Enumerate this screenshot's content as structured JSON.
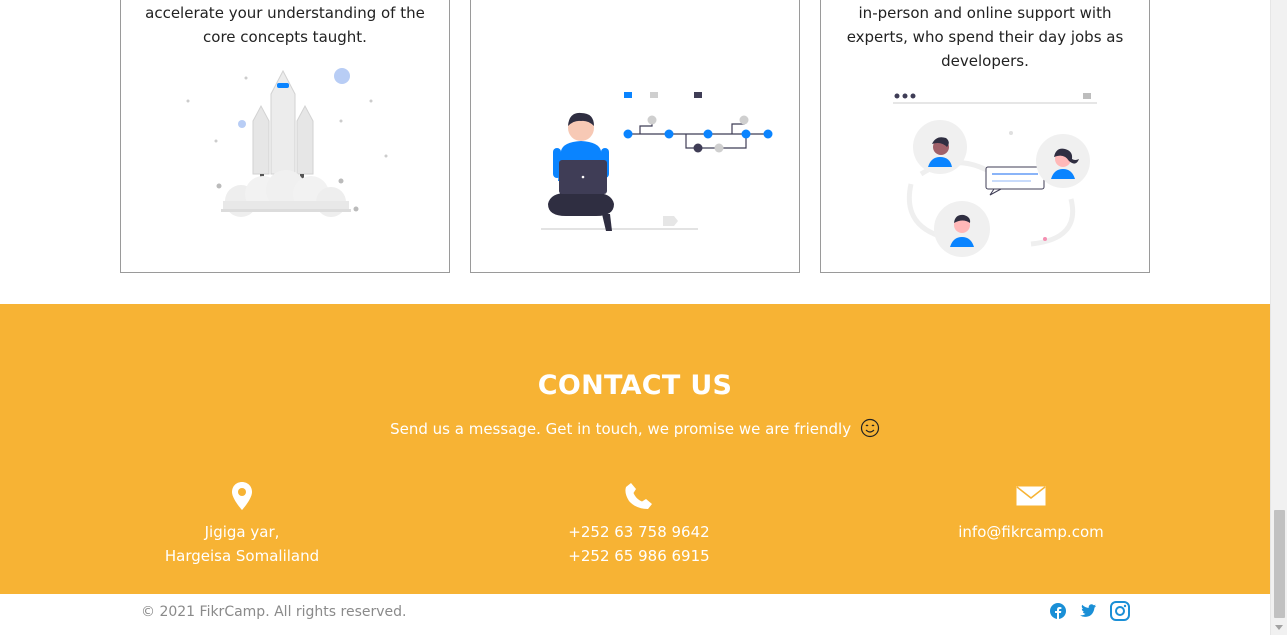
{
  "cards": [
    {
      "text": "accelerate your understanding of the core concepts taught.",
      "illustration": "rocket-illustration"
    },
    {
      "text": "",
      "illustration": "developer-laptop-illustration"
    },
    {
      "text": "in-person and online support with experts, who spend their day jobs as developers.",
      "illustration": "people-chat-illustration"
    }
  ],
  "contact": {
    "title": "CONTACT US",
    "subtitle": "Send us a message. Get in touch, we promise we are friendly",
    "address": {
      "icon": "location-pin-icon",
      "line1": "Jigiga yar,",
      "line2": "Hargeisa Somaliland"
    },
    "phone": {
      "icon": "phone-icon",
      "line1": "+252 63 758 9642",
      "line2": "+252 65 986 6915"
    },
    "email": {
      "icon": "envelope-icon",
      "value": "info@fikrcamp.com"
    }
  },
  "footer": {
    "copyright": "© 2021 FikrCamp. All rights reserved.",
    "socials": [
      "facebook-icon",
      "twitter-icon",
      "instagram-icon"
    ]
  },
  "colors": {
    "contact_bg": "#f7b334",
    "accent_blue": "#0a84ff",
    "social_blue": "#1a8fd6"
  }
}
